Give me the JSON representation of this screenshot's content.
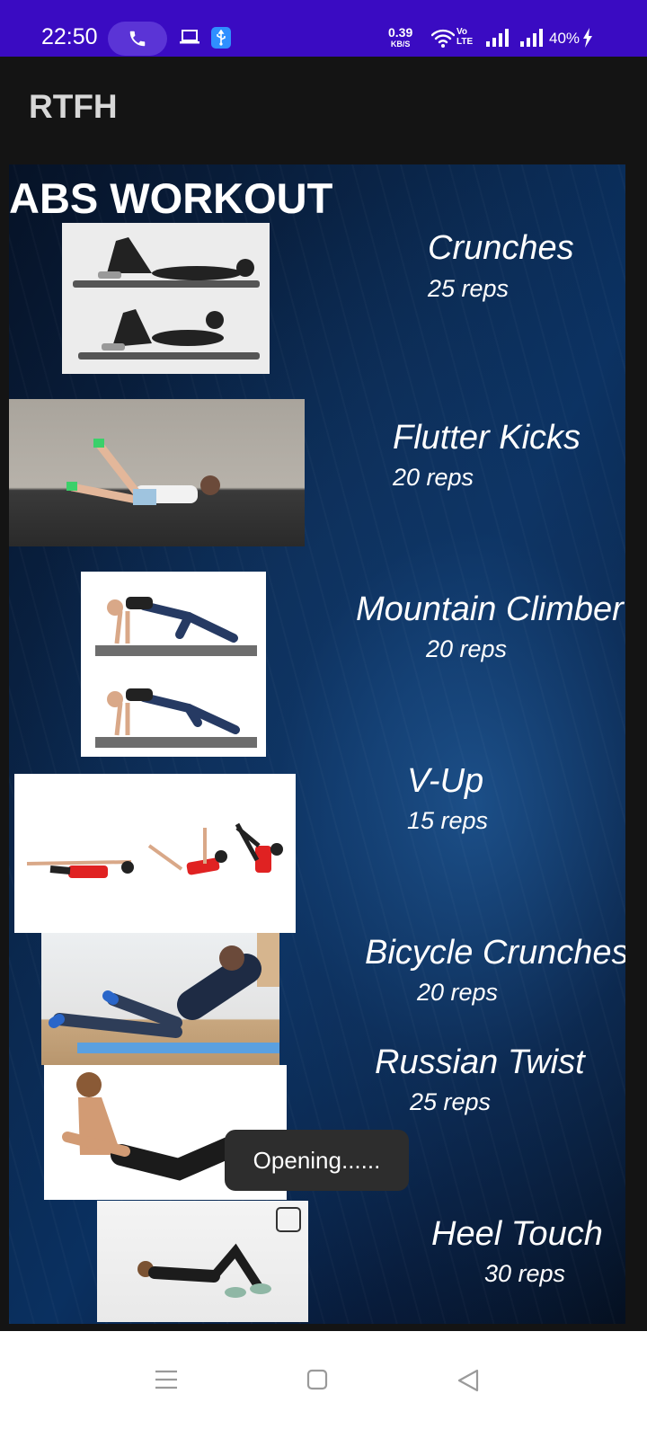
{
  "status_bar": {
    "time": "22:50",
    "net_speed": "0.39",
    "net_speed_unit": "KB/S",
    "volte_top": "Vo",
    "volte_bottom": "LTE",
    "battery": "40%",
    "icons": [
      "phone-call-icon",
      "laptop-icon",
      "usb-icon",
      "wifi-icon",
      "signal-icon",
      "signal-icon",
      "charging-bolt-icon"
    ]
  },
  "app_bar": {
    "title": "RTFH"
  },
  "page": {
    "title": "ABS WORKOUT"
  },
  "exercises": [
    {
      "name": "Crunches",
      "reps": "25 reps"
    },
    {
      "name": "Flutter Kicks",
      "reps": "20 reps"
    },
    {
      "name": "Mountain Climber",
      "reps": "20 reps"
    },
    {
      "name": "V-Up",
      "reps": "15 reps"
    },
    {
      "name": "Bicycle Crunches",
      "reps": "20 reps"
    },
    {
      "name": "Russian Twist",
      "reps": "25 reps"
    },
    {
      "name": "Heel Touch",
      "reps": "30 reps"
    }
  ],
  "toast": {
    "text": "Opening......"
  },
  "nav_bar": {
    "icons": [
      "menu-icon",
      "home-square-icon",
      "back-triangle-icon"
    ]
  }
}
